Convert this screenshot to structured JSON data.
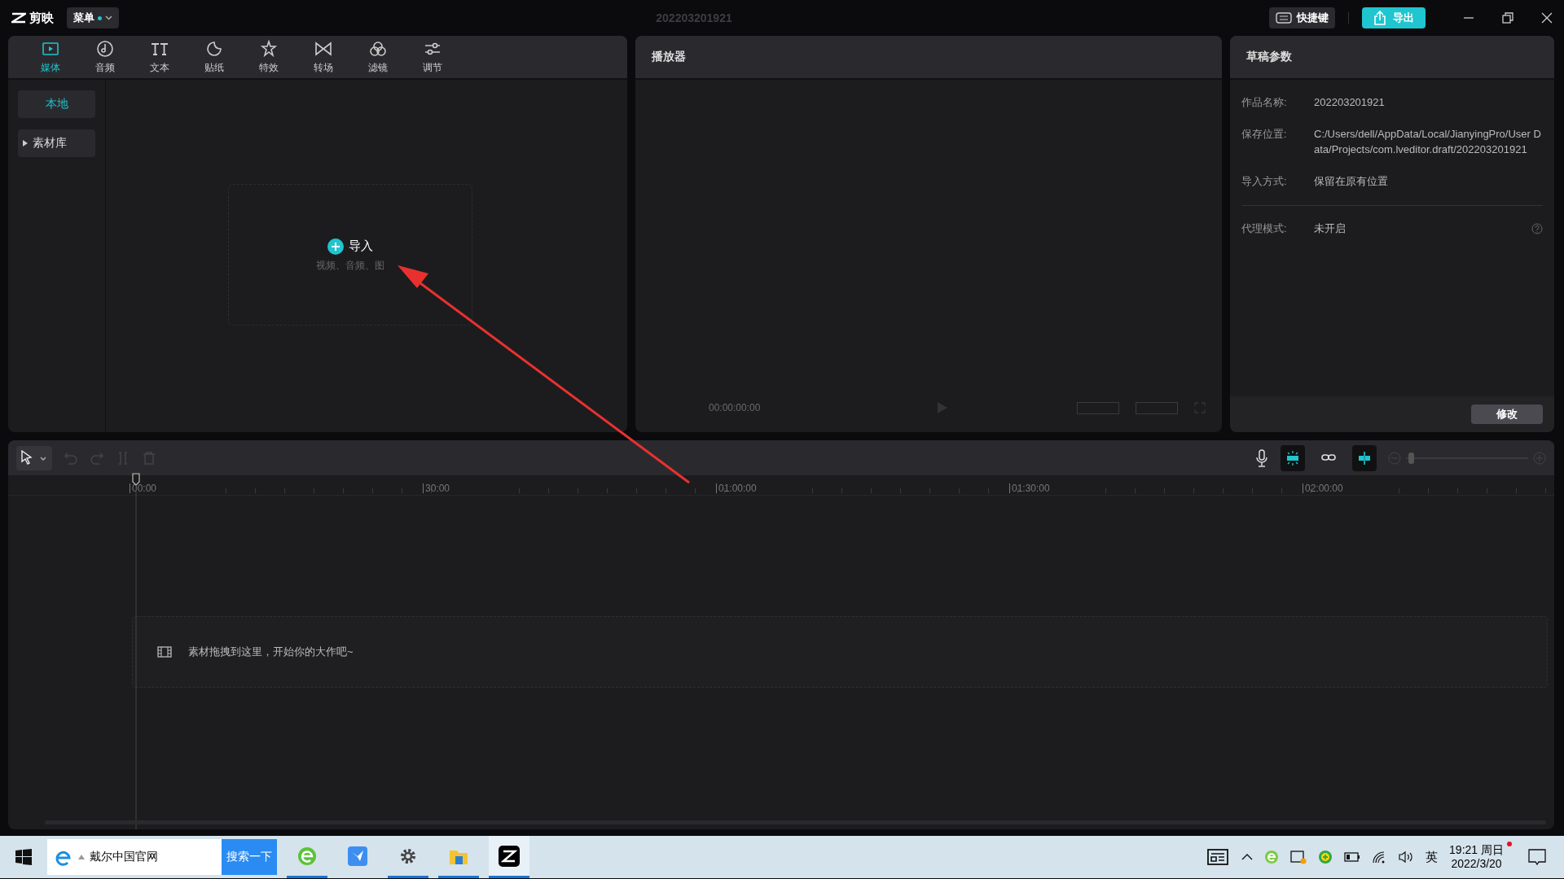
{
  "app": {
    "name": "剪映",
    "menu": "菜单",
    "menu_dot": true,
    "project_title": "202203201921",
    "shortcuts": "快捷键",
    "export": "导出"
  },
  "media_tabs": [
    {
      "label": "媒体",
      "selected": true
    },
    {
      "label": "音频",
      "selected": false
    },
    {
      "label": "文本",
      "selected": false
    },
    {
      "label": "贴纸",
      "selected": false
    },
    {
      "label": "特效",
      "selected": false
    },
    {
      "label": "转场",
      "selected": false
    },
    {
      "label": "滤镜",
      "selected": false
    },
    {
      "label": "调节",
      "selected": false
    }
  ],
  "sidebar": {
    "items": [
      {
        "label": "本地",
        "selected": true,
        "kind": "plain"
      },
      {
        "label": "素材库",
        "selected": false,
        "kind": "folder",
        "expanded": false
      }
    ]
  },
  "import_box": {
    "label": "导入",
    "hint": "视频、音频、图"
  },
  "player": {
    "title": "播放器",
    "timecode": "00:00:00:00"
  },
  "draft": {
    "title": "草稿参数",
    "fields": [
      {
        "label": "作品名称:",
        "value": "202203201921"
      },
      {
        "label": "保存位置:",
        "value": "C:/Users/dell/AppData/Local/JianyingPro/User Data/Projects/com.lveditor.draft/202203201921"
      },
      {
        "label": "导入方式:",
        "value": "保留在原有位置"
      }
    ],
    "proxy": {
      "label": "代理模式:",
      "value": "未开启"
    },
    "edit_button": "修改"
  },
  "timeline": {
    "toggles": [
      {
        "on": true
      },
      {
        "on": false
      },
      {
        "on": true
      }
    ],
    "zoom": {
      "level": 0.02
    },
    "ruler": [
      "00:00",
      "30:00",
      "01:00:00",
      "01:30:00",
      "02:00:00"
    ],
    "drop_hint": "素材拖拽到这里，开始你的大作吧~"
  },
  "taskbar": {
    "search_text": "戴尔中国官网",
    "search_button": "搜索一下",
    "apps": [
      {
        "running": true,
        "selected": false
      },
      {
        "running": false,
        "selected": false
      },
      {
        "running": true,
        "selected": false
      },
      {
        "running": true,
        "selected": false
      },
      {
        "running": true,
        "selected": true
      }
    ],
    "ime": "英",
    "time": "19:21 周日",
    "date": "2022/3/20",
    "notification_dot": true
  }
}
